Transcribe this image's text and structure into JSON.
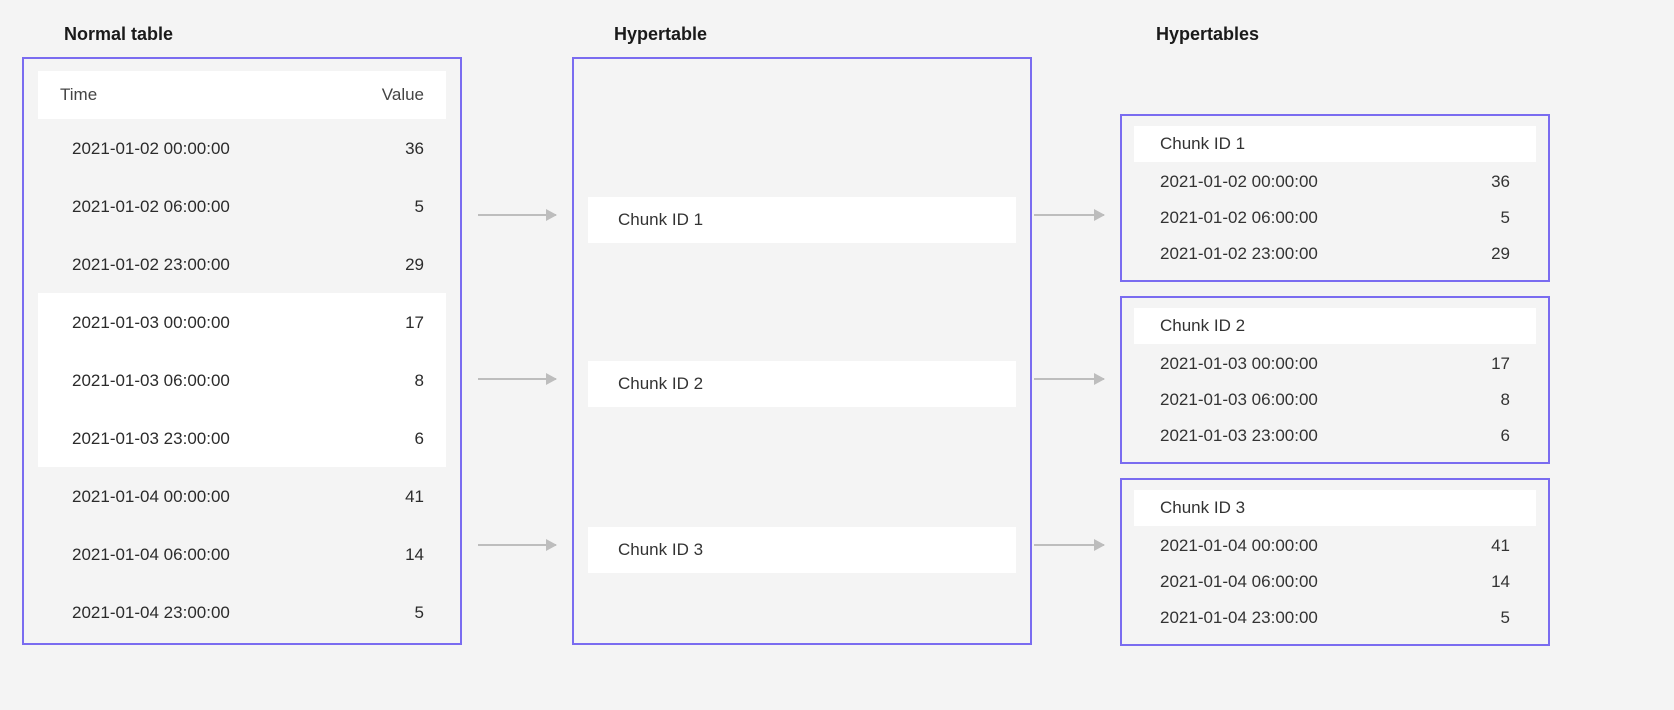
{
  "titles": {
    "normal": "Normal table",
    "hypertable": "Hypertable",
    "hypertables": "Hypertables"
  },
  "normal_table": {
    "columns": {
      "time": "Time",
      "value": "Value"
    },
    "groups": [
      {
        "highlight": false,
        "rows": [
          {
            "time": "2021-01-02 00:00:00",
            "value": "36"
          },
          {
            "time": "2021-01-02 06:00:00",
            "value": "5"
          },
          {
            "time": "2021-01-02 23:00:00",
            "value": "29"
          }
        ]
      },
      {
        "highlight": true,
        "rows": [
          {
            "time": "2021-01-03 00:00:00",
            "value": "17"
          },
          {
            "time": "2021-01-03 06:00:00",
            "value": "8"
          },
          {
            "time": "2021-01-03 23:00:00",
            "value": "6"
          }
        ]
      },
      {
        "highlight": false,
        "rows": [
          {
            "time": "2021-01-04 00:00:00",
            "value": "41"
          },
          {
            "time": "2021-01-04 06:00:00",
            "value": "14"
          },
          {
            "time": "2021-01-04 23:00:00",
            "value": "5"
          }
        ]
      }
    ]
  },
  "hypertable": {
    "chunks": [
      {
        "label": "Chunk ID 1"
      },
      {
        "label": "Chunk ID 2"
      },
      {
        "label": "Chunk ID 3"
      }
    ]
  },
  "hypertables": [
    {
      "label": "Chunk ID 1",
      "rows": [
        {
          "time": "2021-01-02 00:00:00",
          "value": "36"
        },
        {
          "time": "2021-01-02 06:00:00",
          "value": "5"
        },
        {
          "time": "2021-01-02 23:00:00",
          "value": "29"
        }
      ]
    },
    {
      "label": "Chunk ID 2",
      "rows": [
        {
          "time": "2021-01-03 00:00:00",
          "value": "17"
        },
        {
          "time": "2021-01-03 06:00:00",
          "value": "8"
        },
        {
          "time": "2021-01-03 23:00:00",
          "value": "6"
        }
      ]
    },
    {
      "label": "Chunk ID 3",
      "rows": [
        {
          "time": "2021-01-04 00:00:00",
          "value": "41"
        },
        {
          "time": "2021-01-04 06:00:00",
          "value": "14"
        },
        {
          "time": "2021-01-04 23:00:00",
          "value": "5"
        }
      ]
    }
  ]
}
